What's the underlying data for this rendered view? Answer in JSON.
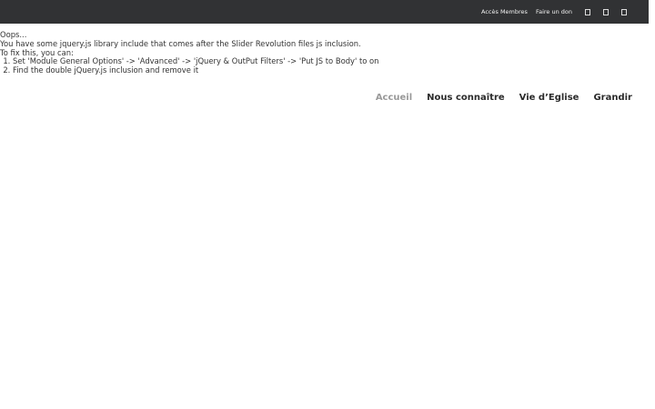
{
  "topbar": {
    "links": [
      "Accès Membres",
      "Faire un don"
    ],
    "icons": [
      "facebook-icon",
      "instagram-icon",
      "youtube-icon"
    ]
  },
  "error_message": {
    "line1": "Oops...",
    "line2": "You have some jquery.js library include that comes after the Slider Revolution files js inclusion.",
    "line3": "To fix this, you can:",
    "steps": [
      "Set 'Module General Options' -> 'Advanced' -> 'jQuery & OutPut Filters' -> 'Put JS to Body' to on",
      "Find the double jQuery.js inclusion and remove it"
    ]
  },
  "main_nav": {
    "items": [
      "Accueil",
      "Nous connaître",
      "Vie d’Eglise",
      "Grandir"
    ],
    "active": "Accueil"
  }
}
